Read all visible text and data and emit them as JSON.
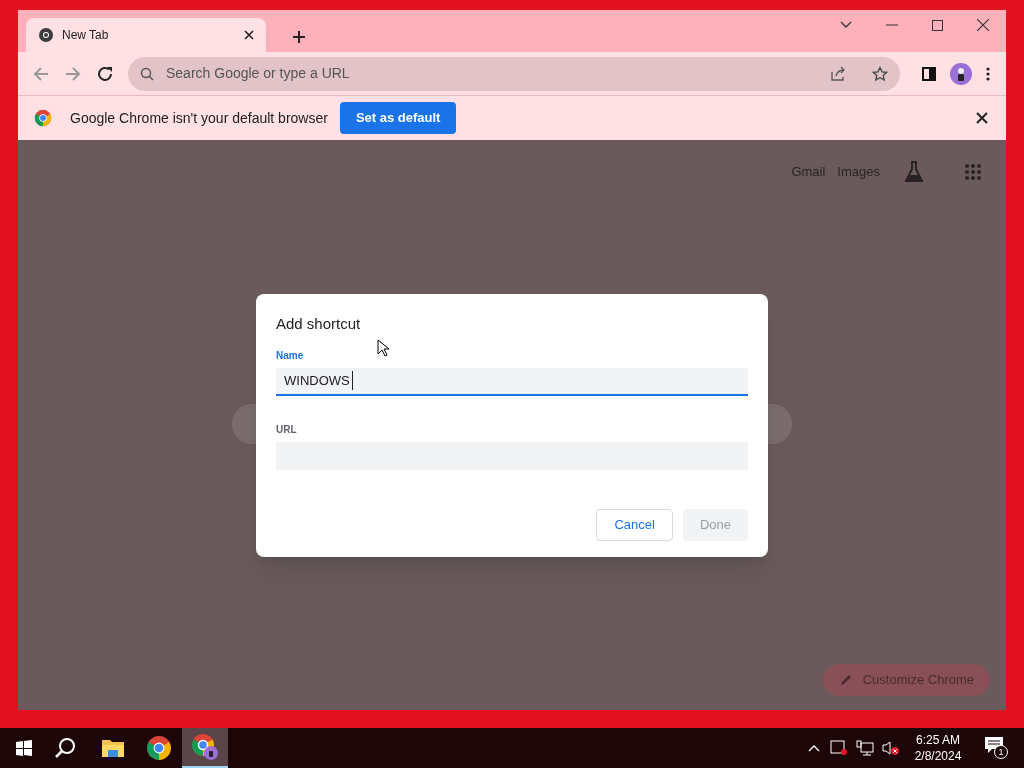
{
  "tabs": [
    {
      "title": "New Tab",
      "selected": true
    }
  ],
  "address_bar": {
    "placeholder": "Search Google or type a URL"
  },
  "infobar": {
    "message": "Google Chrome isn't your default browser",
    "button": "Set as default"
  },
  "page": {
    "links": [
      "Gmail",
      "Images"
    ],
    "customize_button": "Customize Chrome"
  },
  "dialog": {
    "title": "Add shortcut",
    "fields": [
      {
        "label": "Name",
        "value": "WINDOWS",
        "focused": true
      },
      {
        "label": "URL",
        "focused": false
      }
    ],
    "buttons": [
      {
        "label": "Cancel",
        "disabled": false
      },
      {
        "label": "Done",
        "disabled": true
      }
    ]
  },
  "taskbar": {
    "apps": [
      {
        "kind": "folder",
        "selected": false
      },
      {
        "kind": "chrome",
        "selected": false
      },
      {
        "kind": "chrome-profile",
        "selected": true
      }
    ],
    "clock": {
      "time": "6:25 AM",
      "date": "2/8/2024"
    },
    "notifications": {
      "count": "1"
    }
  }
}
